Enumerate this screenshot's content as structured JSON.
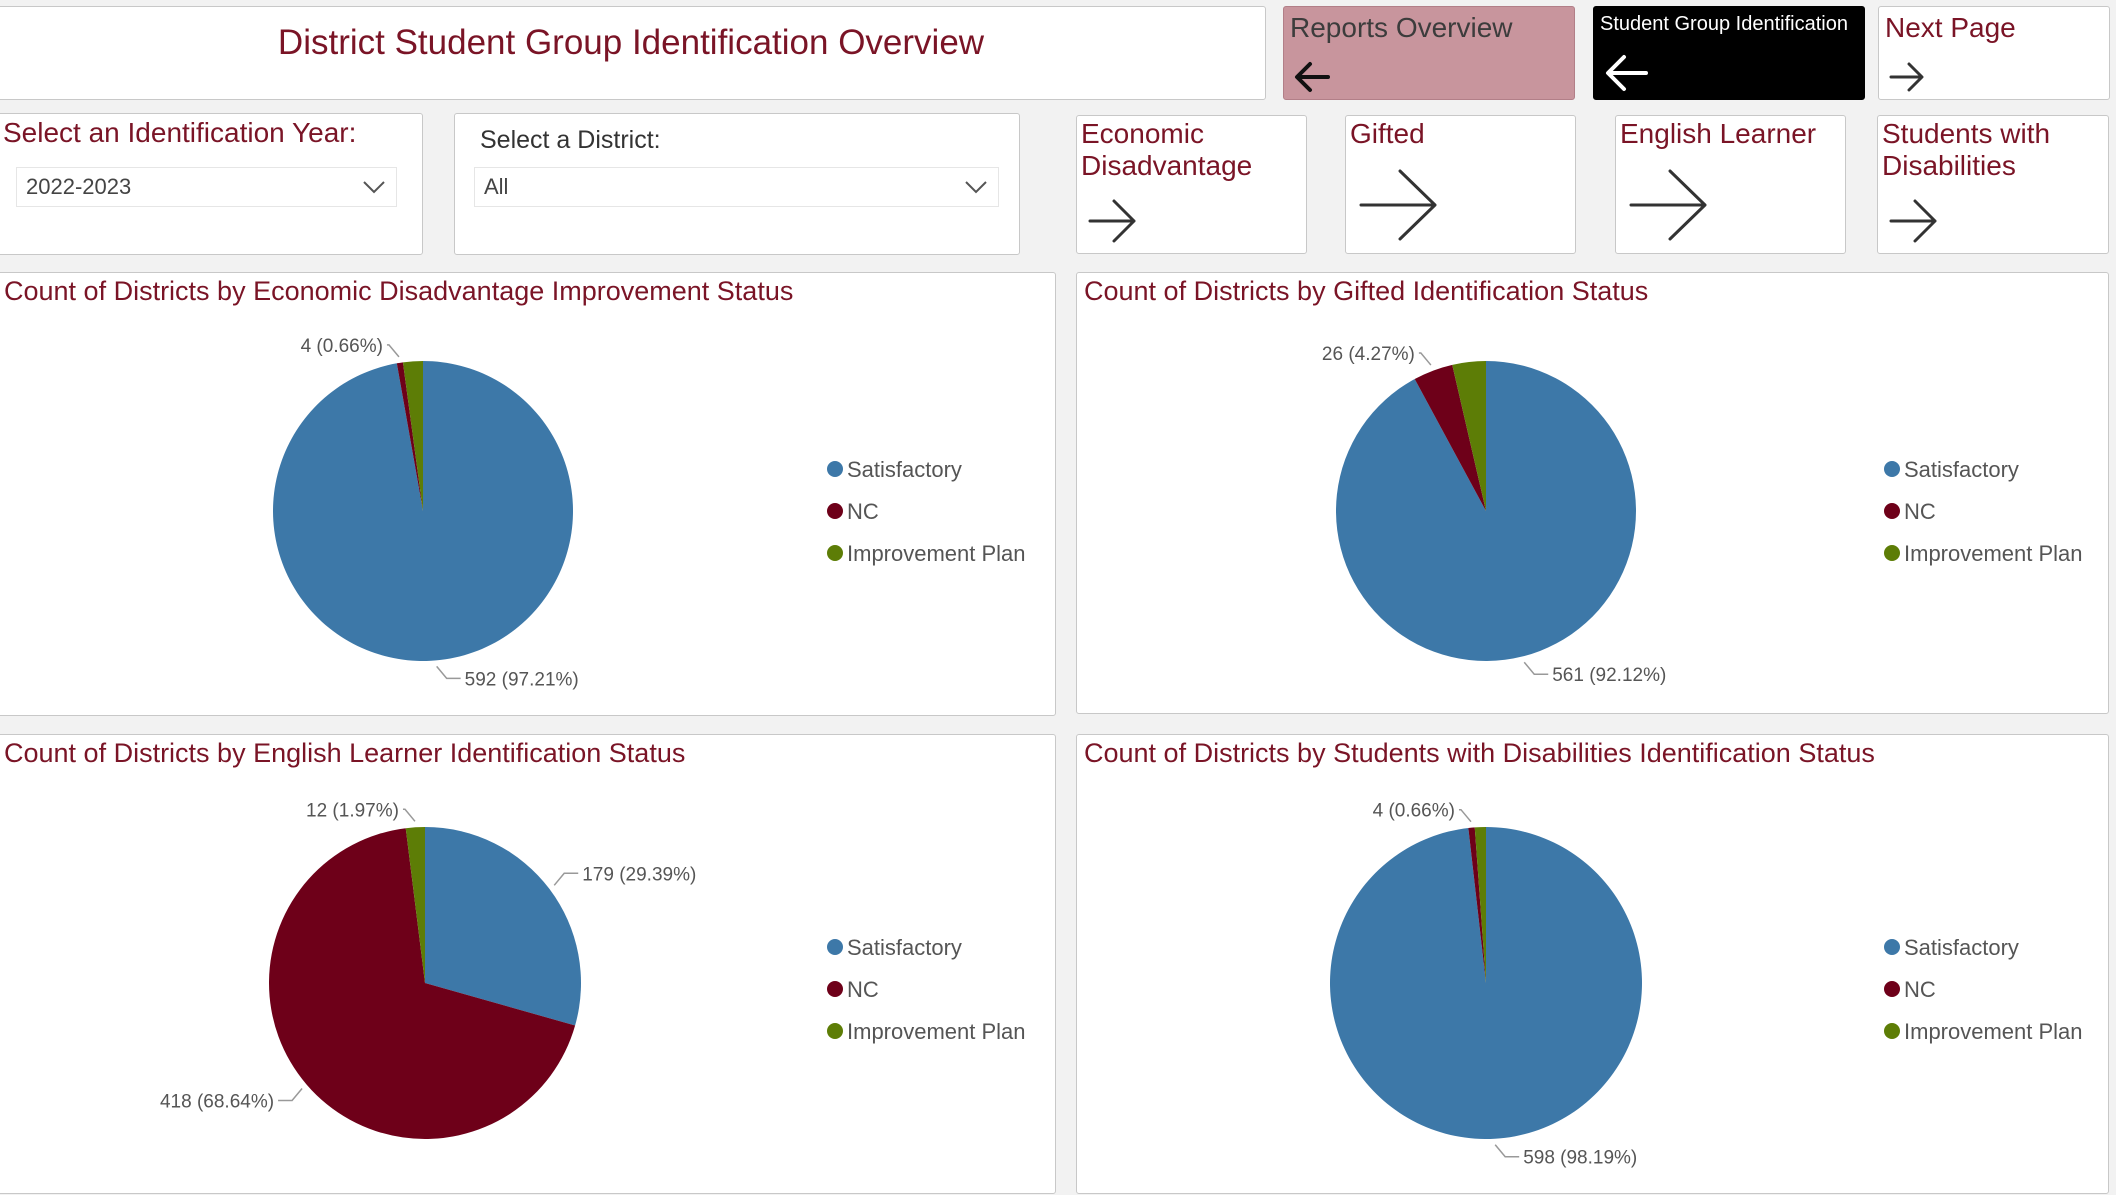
{
  "header": {
    "title": "District Student Group Identification Overview"
  },
  "nav": {
    "reports_overview": "Reports Overview",
    "student_group_identification": "Student Group Identification",
    "next_page": "Next Page"
  },
  "filters": {
    "year_label": "Select an Identification Year:",
    "year_value": "2022-2023",
    "district_label": "Select a District:",
    "district_value": "All"
  },
  "group_buttons": {
    "economic": "Economic Disadvantage",
    "gifted": "Gifted",
    "english_learner": "English Learner",
    "swd": "Students with Disabilities"
  },
  "colors": {
    "Satisfactory": "#3d78a8",
    "NC": "#6e0019",
    "Improvement Plan": "#5d7d06",
    "title_accent": "#7a1426"
  },
  "chart_data": [
    {
      "id": "econ",
      "type": "pie",
      "title": "Count of Districts by Economic Disadvantage Improvement Status",
      "categories": [
        "Satisfactory",
        "NC",
        "Improvement Plan"
      ],
      "values": [
        592,
        4,
        13
      ],
      "data_labels": [
        "592 (97.21%)",
        "4 (0.66%)",
        ""
      ],
      "legend": [
        "Satisfactory",
        "NC",
        "Improvement Plan"
      ],
      "legend_position": "right"
    },
    {
      "id": "gifted",
      "type": "pie",
      "title": "Count of Districts by Gifted Identification Status",
      "categories": [
        "Satisfactory",
        "NC",
        "Improvement Plan"
      ],
      "values": [
        561,
        26,
        22
      ],
      "data_labels": [
        "561 (92.12%)",
        "26 (4.27%)",
        ""
      ],
      "legend": [
        "Satisfactory",
        "NC",
        "Improvement Plan"
      ],
      "legend_position": "right"
    },
    {
      "id": "el",
      "type": "pie",
      "title": "Count of Districts by English Learner Identification Status",
      "categories": [
        "Satisfactory",
        "NC",
        "Improvement Plan"
      ],
      "values": [
        179,
        418,
        12
      ],
      "data_labels": [
        "179 (29.39%)",
        "418 (68.64%)",
        "12 (1.97%)"
      ],
      "legend": [
        "Satisfactory",
        "NC",
        "Improvement Plan"
      ],
      "legend_position": "right"
    },
    {
      "id": "swd",
      "type": "pie",
      "title": "Count of Districts by Students with Disabilities Identification Status",
      "categories": [
        "Satisfactory",
        "NC",
        "Improvement Plan"
      ],
      "values": [
        598,
        4,
        7
      ],
      "data_labels": [
        "598 (98.19%)",
        "4 (0.66%)",
        ""
      ],
      "legend": [
        "Satisfactory",
        "NC",
        "Improvement Plan"
      ],
      "legend_position": "right"
    }
  ]
}
